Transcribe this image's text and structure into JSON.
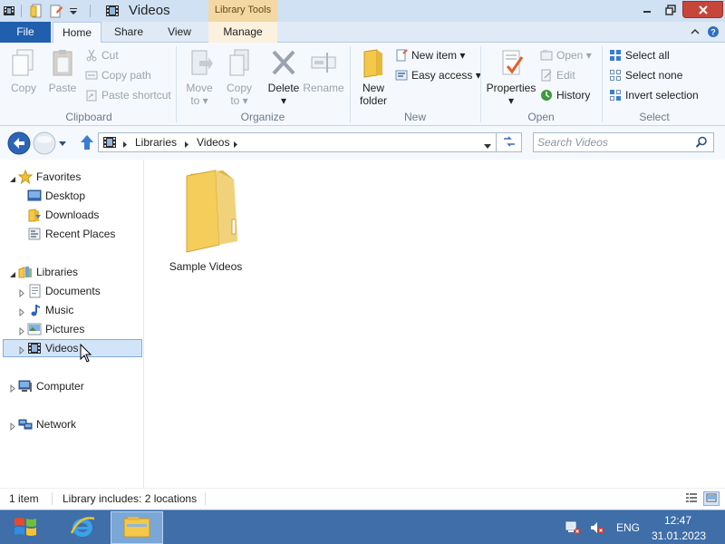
{
  "window": {
    "title": "Videos",
    "contextual_tab_group": "Library Tools"
  },
  "ribbon_tabs": [
    {
      "label": "File"
    },
    {
      "label": "Home",
      "active": true
    },
    {
      "label": "Share"
    },
    {
      "label": "View"
    },
    {
      "label": "Manage"
    }
  ],
  "ribbon": {
    "clipboard": {
      "copy": "Copy",
      "paste": "Paste",
      "cut": "Cut",
      "copy_path": "Copy path",
      "paste_shortcut": "Paste shortcut",
      "group_label": "Clipboard"
    },
    "organize": {
      "move_to": [
        "Move",
        "to"
      ],
      "copy_to": [
        "Copy",
        "to"
      ],
      "delete": "Delete",
      "rename": "Rename",
      "group_label": "Organize"
    },
    "new": {
      "new_folder": [
        "New",
        "folder"
      ],
      "new_item": "New item",
      "easy_access": "Easy access",
      "group_label": "New"
    },
    "open": {
      "properties": "Properties",
      "open": "Open",
      "edit": "Edit",
      "history": "History",
      "group_label": "Open"
    },
    "select": {
      "select_all": "Select all",
      "select_none": "Select none",
      "invert_selection": "Invert selection",
      "group_label": "Select"
    }
  },
  "address": {
    "breadcrumbs": [
      "Libraries",
      "Videos"
    ],
    "search_placeholder": "Search Videos"
  },
  "nav_pane": {
    "favorites": {
      "label": "Favorites",
      "items": [
        "Desktop",
        "Downloads",
        "Recent Places"
      ]
    },
    "libraries": {
      "label": "Libraries",
      "items": [
        "Documents",
        "Music",
        "Pictures",
        "Videos"
      ],
      "selected": "Videos"
    },
    "computer": "Computer",
    "network": "Network"
  },
  "content": {
    "items": [
      {
        "name": "Sample Videos",
        "type": "folder"
      }
    ]
  },
  "status_bar": {
    "item_count": "1 item",
    "library_info": "Library includes: 2 locations"
  },
  "taskbar": {
    "language": "ENG",
    "time": "12:47",
    "date": "31.01.2023"
  },
  "colors": {
    "file_tab": "#1f5fae",
    "close_button": "#c7463a",
    "library_tools": "#f3d8a3",
    "selection": "#d2e4f7",
    "taskbar": "#3f6ea8"
  }
}
